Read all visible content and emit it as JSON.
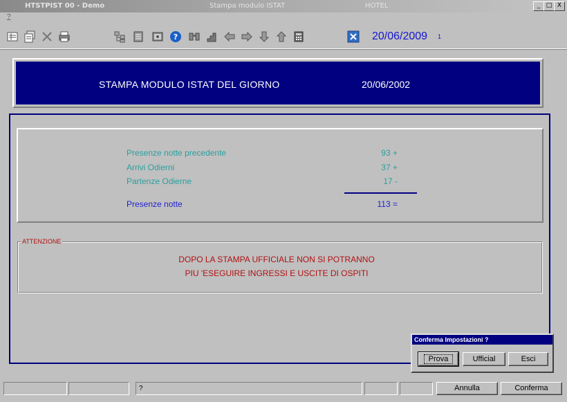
{
  "window": {
    "title_app": "HTSTPIST 00 - Demo",
    "title_form": "Stampa modulo ISTAT",
    "title_module": "HOTEL",
    "btn_minimize": "_",
    "btn_maximize": "□",
    "btn_close": "X"
  },
  "menu": {
    "help": "?"
  },
  "toolbar": {
    "icons": [
      "list-icon",
      "copy-list-icon",
      "delete-icon",
      "print-icon",
      "tree-icon",
      "sheet-icon",
      "image-icon",
      "help-icon",
      "binoculars-icon",
      "stairs-icon",
      "arrow-left-icon",
      "arrow-right-icon",
      "arrow-down-icon",
      "arrow-up-icon",
      "calculator-icon",
      "close-icon"
    ],
    "date": "20/06/2009",
    "page": "1"
  },
  "header": {
    "title": "STAMPA MODULO ISTAT DEL GIORNO",
    "date": "20/06/2002"
  },
  "counts": {
    "previous_label": "Presenze notte precedente",
    "previous_value": "93 +",
    "arrivals_label": "Arrivi Odierni",
    "arrivals_value": "37 +",
    "departures_label": "Partenze Odierne",
    "departures_value": "17 -",
    "total_label": "Presenze notte",
    "total_value": "113 ="
  },
  "attention": {
    "legend": "ATTENZIONE",
    "line1": "DOPO LA STAMPA UFFICIALE NON SI POTRANNO",
    "line2": "PIU 'ESEGUIRE INGRESSI E USCITE DI OSPITI"
  },
  "dialog": {
    "title": "Conferma Impostazioni ?",
    "prova": "Prova",
    "ufficial": "Ufficial",
    "esci": "Esci"
  },
  "statusbar": {
    "field3": "?",
    "annulla": "Annulla",
    "conferma": "Conferma"
  },
  "colors": {
    "accent_navy": "#000080",
    "label_teal": "#2a9e9e",
    "warning_red": "#b01010",
    "date_blue": "#1515d0"
  }
}
